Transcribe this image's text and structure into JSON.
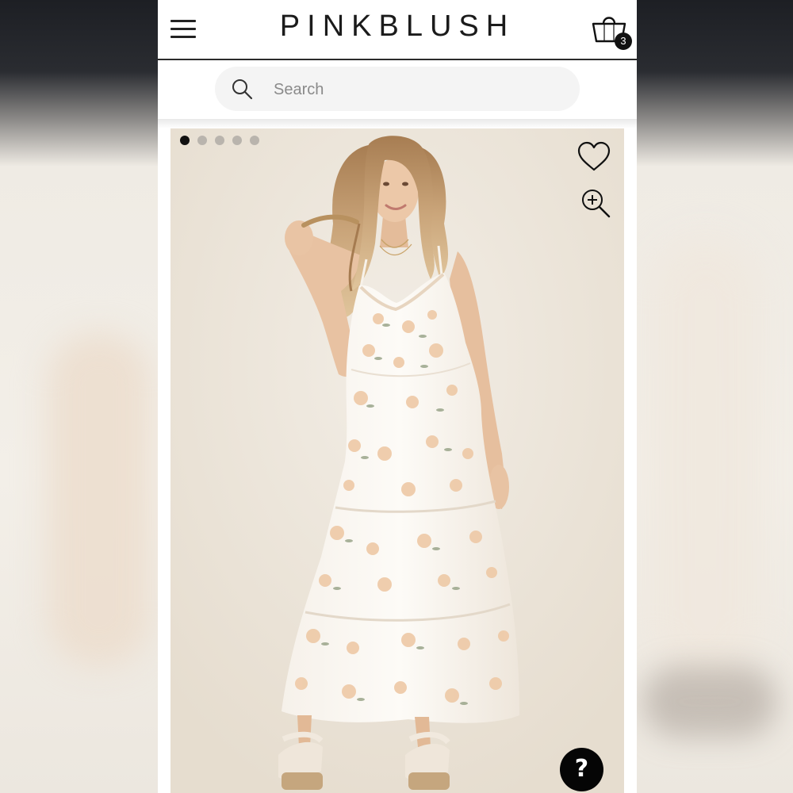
{
  "header": {
    "logo": "PINKBLUSH",
    "menu_icon": "hamburger-menu-icon",
    "cart_icon": "shopping-bag-icon",
    "cart_count": "3"
  },
  "search": {
    "placeholder": "Search",
    "icon": "search-icon"
  },
  "product_gallery": {
    "image_count": 5,
    "active_index": 0,
    "wishlist_icon": "heart-icon",
    "zoom_icon": "zoom-in-icon",
    "image_subject": "model-wearing-ivory-floral-maternity-maxi-dress"
  },
  "help": {
    "glyph": "?",
    "icon": "help-icon"
  },
  "colors": {
    "text": "#1b1b1b",
    "search_bg": "#f4f4f4",
    "active_dot": "#111111",
    "inactive_dot": "#b9b4ad",
    "help_bg": "#050505",
    "photo_bg": "#ebe4d9"
  }
}
